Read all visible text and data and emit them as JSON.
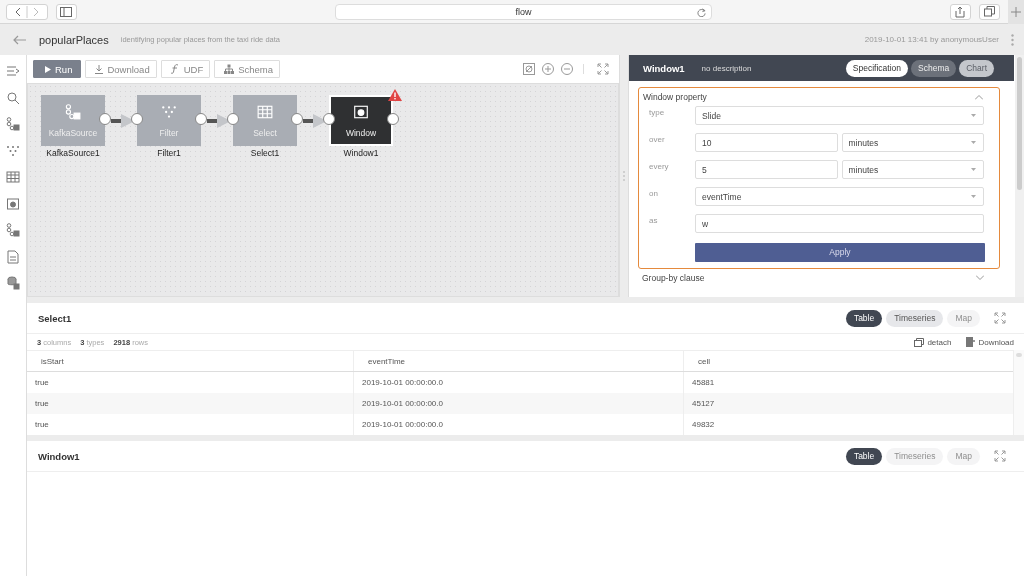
{
  "browser": {
    "address": "flow"
  },
  "header": {
    "title": "popularPlaces",
    "description": "identifying popular places from the taxi ride data",
    "meta": "2019-10-01 13:41 by anonymousUser"
  },
  "toolbar": [
    {
      "label": "Run",
      "kind": "run"
    },
    {
      "label": "Download",
      "kind": "download"
    },
    {
      "label": "UDF",
      "kind": "udf"
    },
    {
      "label": "Schema",
      "kind": "schema"
    }
  ],
  "nodes": [
    {
      "type": "KafkaSource",
      "name": "KafkaSource1",
      "kind": "source",
      "selected": false,
      "warning": false
    },
    {
      "type": "Filter",
      "name": "Filter1",
      "kind": "filter",
      "selected": false,
      "warning": false
    },
    {
      "type": "Select",
      "name": "Select1",
      "kind": "select",
      "selected": false,
      "warning": false
    },
    {
      "type": "Window",
      "name": "Window1",
      "kind": "window",
      "selected": true,
      "warning": true
    }
  ],
  "panel": {
    "title": "Window1",
    "description": "no description",
    "tabs": [
      {
        "label": "Specification",
        "selected": true,
        "disabled": false
      },
      {
        "label": "Schema",
        "selected": false,
        "disabled": false
      },
      {
        "label": "Chart",
        "selected": false,
        "disabled": true
      }
    ],
    "sections": [
      {
        "title": "Window property",
        "expanded": true,
        "button": "Apply",
        "rows": [
          {
            "label": "type",
            "fields": [
              {
                "kind": "select",
                "value": "Slide"
              }
            ]
          },
          {
            "label": "over",
            "fields": [
              {
                "kind": "input",
                "value": "10"
              },
              {
                "kind": "select",
                "value": "minutes"
              }
            ]
          },
          {
            "label": "every",
            "fields": [
              {
                "kind": "input",
                "value": "5"
              },
              {
                "kind": "select",
                "value": "minutes"
              }
            ]
          },
          {
            "label": "on",
            "fields": [
              {
                "kind": "select",
                "value": "eventTime"
              }
            ]
          },
          {
            "label": "as",
            "fields": [
              {
                "kind": "input",
                "value": "w"
              }
            ]
          }
        ]
      },
      {
        "title": "Group-by clause",
        "expanded": false
      }
    ]
  },
  "results": [
    {
      "title": "Select1",
      "tabs": [
        {
          "label": "Table",
          "selected": true,
          "disabled": false
        },
        {
          "label": "Timeseries",
          "selected": false,
          "disabled": false
        },
        {
          "label": "Map",
          "selected": false,
          "disabled": true
        }
      ],
      "stats": [
        {
          "count": "3",
          "unit": "columns"
        },
        {
          "count": "3",
          "unit": "types"
        },
        {
          "count": "2918",
          "unit": "rows"
        }
      ],
      "actions": [
        {
          "label": "detach",
          "kind": "detach"
        },
        {
          "label": "Download",
          "kind": "download"
        }
      ],
      "table": {
        "columns": [
          "isStart",
          "eventTime",
          "cell"
        ],
        "rows": [
          [
            "true",
            "2019-10-01 00:00:00.0",
            "45881"
          ],
          [
            "true",
            "2019-10-01 00:00:00.0",
            "45127"
          ],
          [
            "true",
            "2019-10-01 00:00:00.0",
            "49832"
          ]
        ]
      }
    },
    {
      "title": "Window1",
      "tabs": [
        {
          "label": "Table",
          "selected": true,
          "disabled": false
        },
        {
          "label": "Timeseries",
          "selected": false,
          "disabled": true
        },
        {
          "label": "Map",
          "selected": false,
          "disabled": true
        }
      ]
    }
  ]
}
